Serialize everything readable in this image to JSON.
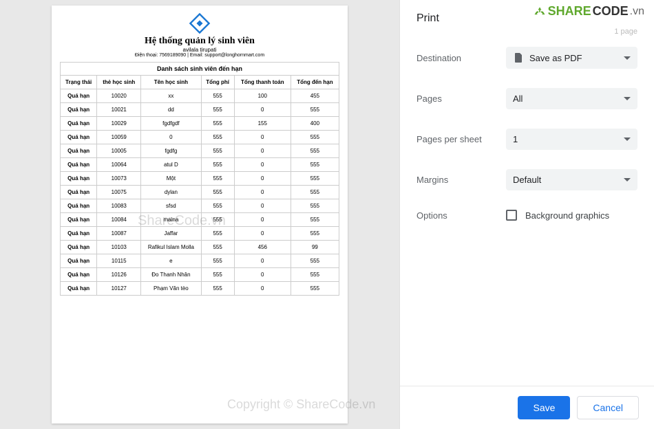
{
  "brand": {
    "share": "SHARE",
    "code": "CODE",
    "vn": ".vn"
  },
  "watermark1": "ShareCode.vn",
  "watermark2": "Copyright © ShareCode.vn",
  "document": {
    "title": "Hệ thống quản lý sinh viên",
    "subtitle": "avilala tirupati",
    "contact": "Điện thoại: 7569189090 | Email: support@longhornmart.com",
    "table_title": "Danh sách sinh viên đến hạn",
    "columns": [
      "Trạng thái",
      "thẻ học sinh",
      "Tên học sinh",
      "Tổng phí",
      "Tổng thanh toán",
      "Tổng đến hạn"
    ],
    "rows": [
      [
        "Quá hạn",
        "10020",
        "xx",
        "555",
        "100",
        "455"
      ],
      [
        "Quá hạn",
        "10021",
        "dd",
        "555",
        "0",
        "555"
      ],
      [
        "Quá hạn",
        "10029",
        "fgdfgdf",
        "555",
        "155",
        "400"
      ],
      [
        "Quá hạn",
        "10059",
        "0",
        "555",
        "0",
        "555"
      ],
      [
        "Quá hạn",
        "10005",
        "fgdfg",
        "555",
        "0",
        "555"
      ],
      [
        "Quá hạn",
        "10064",
        "atul D",
        "555",
        "0",
        "555"
      ],
      [
        "Quá hạn",
        "10073",
        "Một",
        "555",
        "0",
        "555"
      ],
      [
        "Quá hạn",
        "10075",
        "dylan",
        "555",
        "0",
        "555"
      ],
      [
        "Quá hạn",
        "10083",
        "sfsd",
        "555",
        "0",
        "555"
      ],
      [
        "Quá hạn",
        "10084",
        "maina",
        "555",
        "0",
        "555"
      ],
      [
        "Quá hạn",
        "10087",
        "Jaffar",
        "555",
        "0",
        "555"
      ],
      [
        "Quá hạn",
        "10103",
        "Rafikul Islam Molla",
        "555",
        "456",
        "99"
      ],
      [
        "Quá hạn",
        "10115",
        "e",
        "555",
        "0",
        "555"
      ],
      [
        "Quá hạn",
        "10126",
        "Đo Thanh Nhân",
        "555",
        "0",
        "555"
      ],
      [
        "Quá hạn",
        "10127",
        "Phạm Văn tèo",
        "555",
        "0",
        "555"
      ]
    ]
  },
  "print": {
    "title": "Print",
    "page_count": "1 page",
    "destination_label": "Destination",
    "destination_value": "Save as PDF",
    "pages_label": "Pages",
    "pages_value": "All",
    "pps_label": "Pages per sheet",
    "pps_value": "1",
    "margins_label": "Margins",
    "margins_value": "Default",
    "options_label": "Options",
    "bg_graphics_label": "Background graphics",
    "save": "Save",
    "cancel": "Cancel"
  }
}
